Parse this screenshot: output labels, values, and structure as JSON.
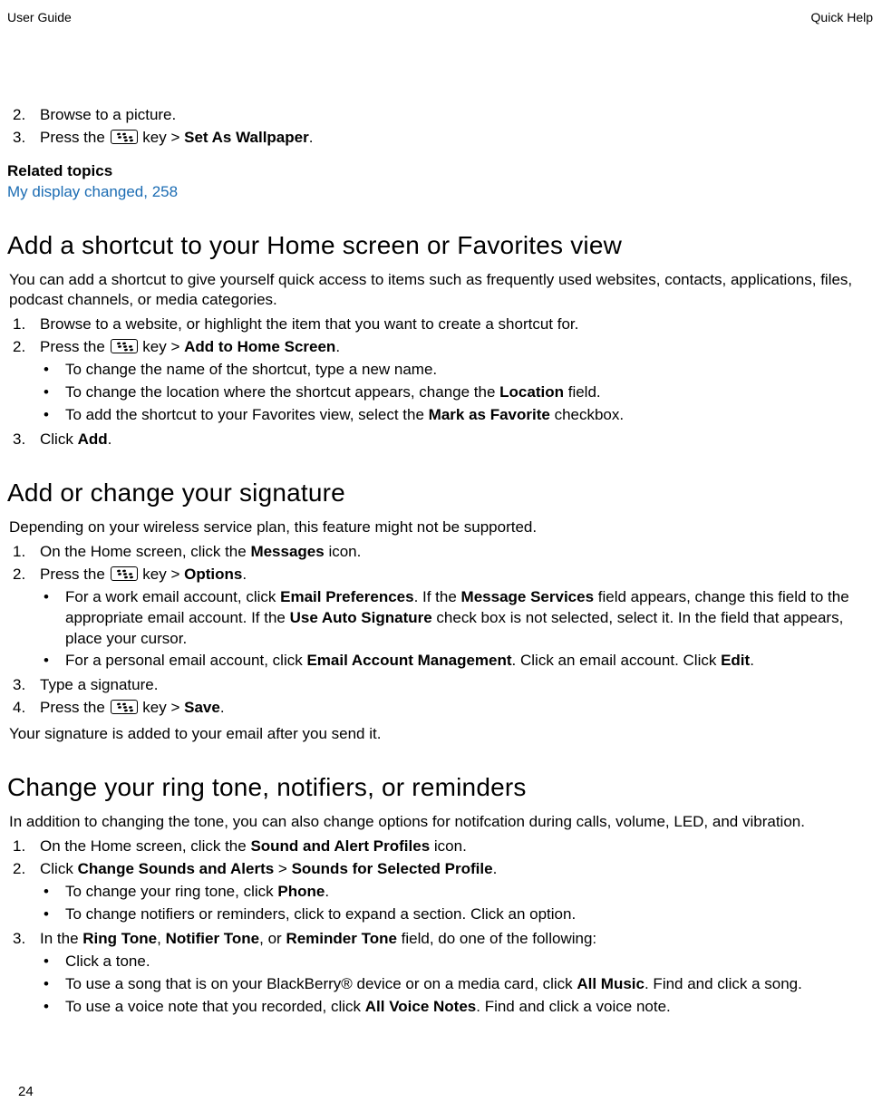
{
  "header": {
    "left": "User Guide",
    "right": "Quick Help"
  },
  "pageNumber": "24",
  "topList": {
    "item2": {
      "num": "2.",
      "text": "Browse to a picture."
    },
    "item3": {
      "num": "3.",
      "pre": "Press the ",
      "post": " key > ",
      "bold": "Set As Wallpaper",
      "end": "."
    }
  },
  "related": {
    "heading": "Related topics",
    "link": "My display changed, 258"
  },
  "sec1": {
    "title": "Add a shortcut to your Home screen or Favorites view",
    "intro": "You can add a shortcut to give yourself quick access to items such as frequently used websites, contacts, applications, files, podcast channels, or media categories.",
    "i1": {
      "num": "1.",
      "text": "Browse to a website, or highlight the item that you want to create a shortcut for."
    },
    "i2": {
      "num": "2.",
      "pre": "Press the ",
      "post": " key > ",
      "bold": "Add to Home Screen",
      "end": ".",
      "sub1": "To change the name of the shortcut, type a new name.",
      "sub2_pre": "To change the location where the shortcut appears, change the ",
      "sub2_b": "Location",
      "sub2_post": " field.",
      "sub3_pre": "To add the shortcut to your Favorites view, select the ",
      "sub3_b": "Mark as Favorite",
      "sub3_post": " checkbox."
    },
    "i3": {
      "num": "3.",
      "pre": "Click ",
      "bold": "Add",
      "end": "."
    }
  },
  "sec2": {
    "title": "Add or change your signature",
    "intro": "Depending on your wireless service plan, this feature might not be supported.",
    "i1": {
      "num": "1.",
      "pre": "On the Home screen, click the ",
      "bold": "Messages",
      "post": " icon."
    },
    "i2": {
      "num": "2.",
      "pre": "Press the ",
      "post": " key > ",
      "bold": "Options",
      "end": ".",
      "sub1_pre": "For a work email account, click ",
      "sub1_b1": "Email Preferences",
      "sub1_mid1": ". If the ",
      "sub1_b2": "Message Services",
      "sub1_mid2": " field appears, change this field to the appropriate email account. If the ",
      "sub1_b3": "Use Auto Signature",
      "sub1_post": " check box is not selected, select it. In the field that appears, place your cursor.",
      "sub2_pre": "For a personal email account, click ",
      "sub2_b1": "Email Account Management",
      "sub2_mid": ". Click an email account. Click ",
      "sub2_b2": "Edit",
      "sub2_end": "."
    },
    "i3": {
      "num": "3.",
      "text": "Type a signature."
    },
    "i4": {
      "num": "4.",
      "pre": "Press the ",
      "post": " key > ",
      "bold": "Save",
      "end": "."
    },
    "after": "Your signature is added to your email after you send it."
  },
  "sec3": {
    "title": "Change your ring tone, notifiers, or reminders",
    "intro": "In addition to changing the tone, you can also change options for notifcation during calls, volume, LED, and vibration.",
    "i1": {
      "num": "1.",
      "pre": "On the Home screen, click the ",
      "bold": "Sound and Alert Profiles",
      "post": " icon."
    },
    "i2": {
      "num": "2.",
      "pre": "Click ",
      "b1": "Change Sounds and Alerts",
      "mid": " > ",
      "b2": "Sounds for Selected Profile",
      "end": ".",
      "sub1_pre": "To change your ring tone, click ",
      "sub1_b": "Phone",
      "sub1_end": ".",
      "sub2": "To change notifiers or reminders, click to expand a section. Click an option."
    },
    "i3": {
      "num": "3.",
      "pre": "In the ",
      "b1": "Ring Tone",
      "mid1": ", ",
      "b2": "Notifier Tone",
      "mid2": ", or ",
      "b3": "Reminder Tone",
      "post": " field, do one of the following:",
      "sub1": "Click a tone.",
      "sub2_pre": "To use a song that is on your BlackBerry® device or on a media card, click ",
      "sub2_b": "All Music",
      "sub2_post": ". Find and click a song.",
      "sub3_pre": "To use a voice note that you recorded, click ",
      "sub3_b": "All Voice Notes",
      "sub3_post": ". Find and click a voice note."
    }
  }
}
